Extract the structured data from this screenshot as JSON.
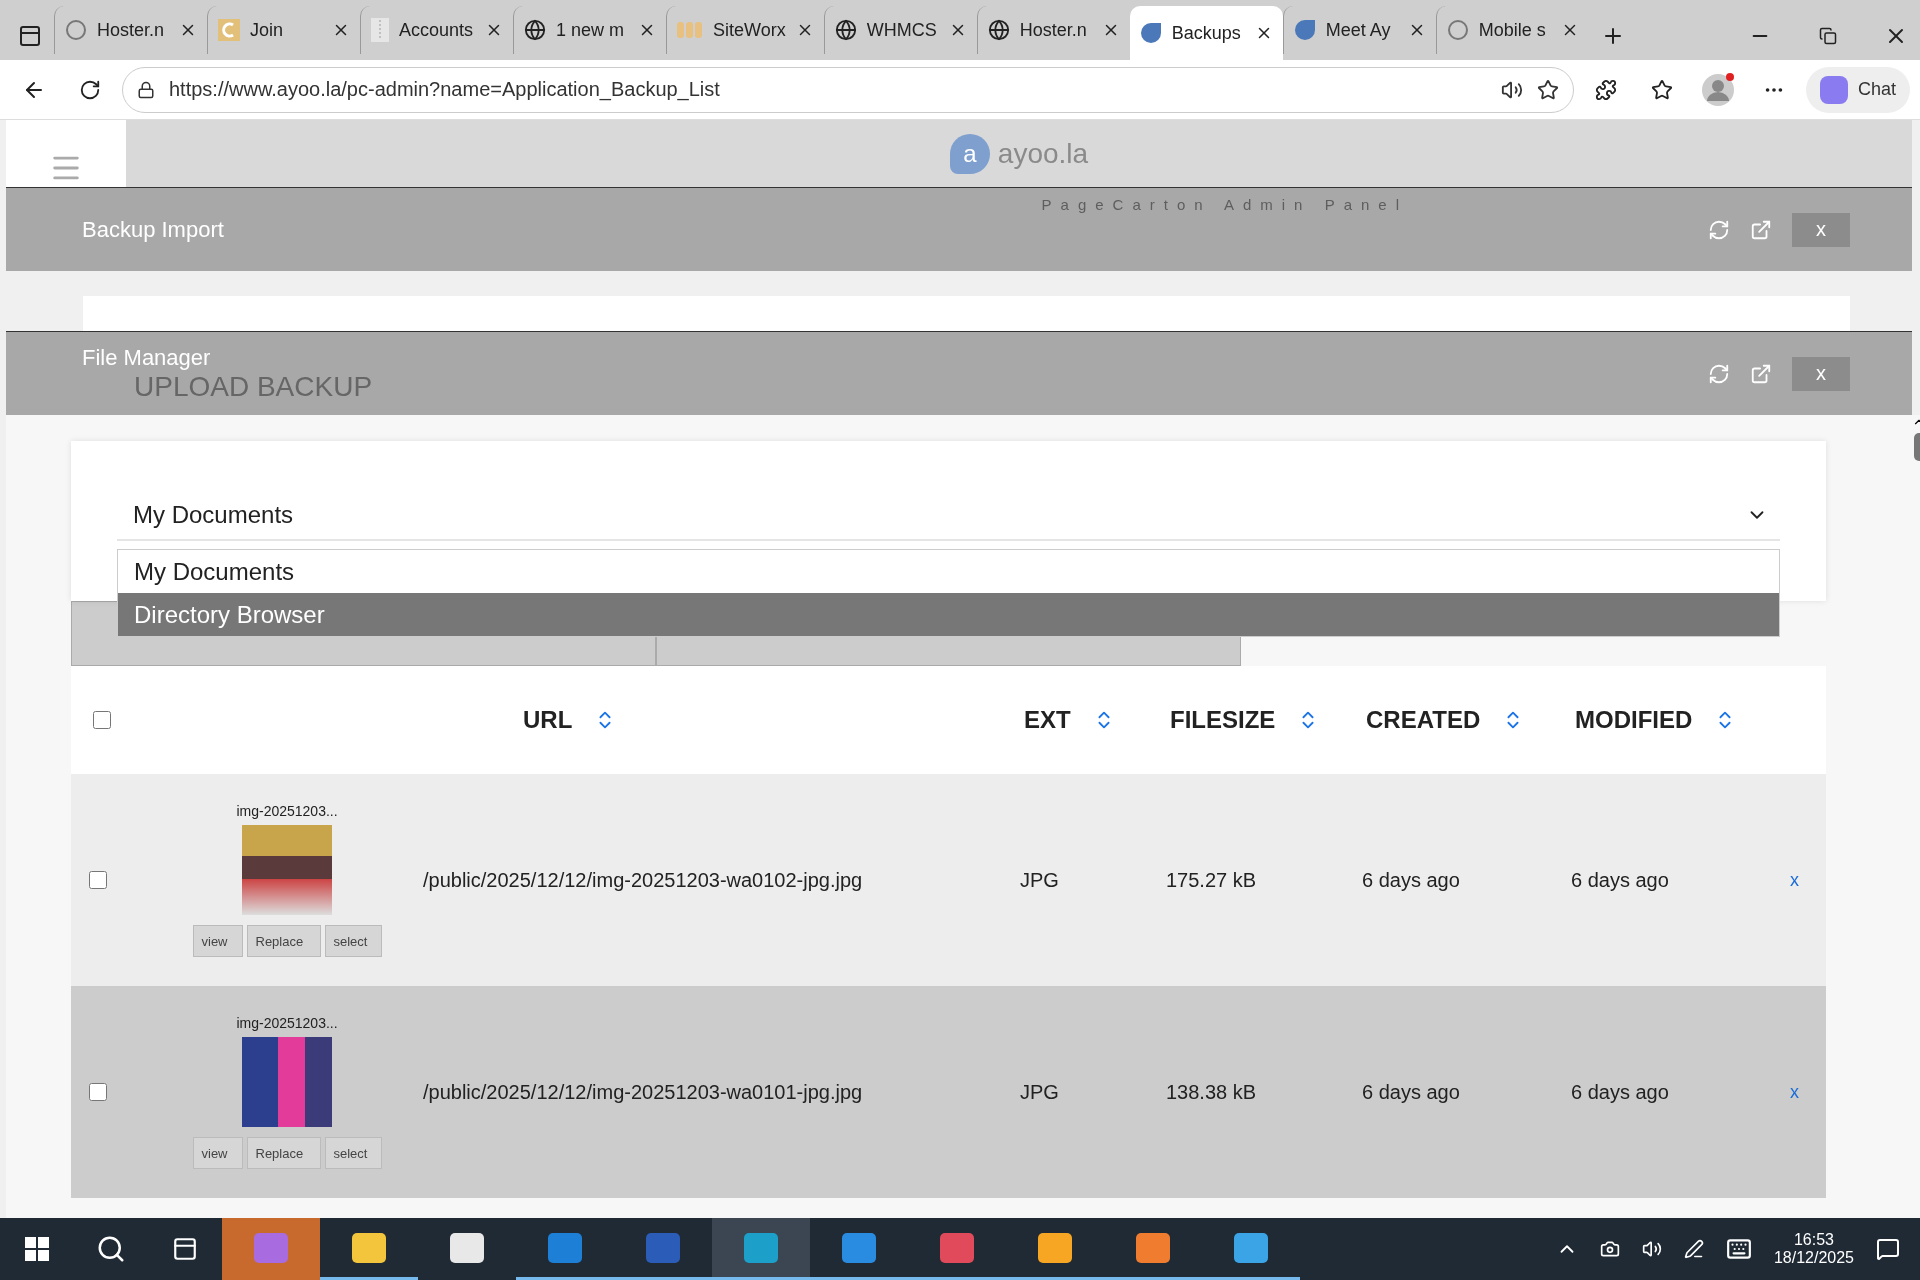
{
  "browser": {
    "tabs": [
      {
        "label": "Hoster.n",
        "selected": false
      },
      {
        "label": "Join",
        "selected": false
      },
      {
        "label": "Accounts",
        "selected": false
      },
      {
        "label": "1 new m",
        "selected": false
      },
      {
        "label": "SiteWorx",
        "selected": false
      },
      {
        "label": "WHMCS",
        "selected": false
      },
      {
        "label": "Hoster.n",
        "selected": false
      },
      {
        "label": "Backups",
        "selected": true
      },
      {
        "label": "Meet Ay",
        "selected": false
      },
      {
        "label": "Mobile s",
        "selected": false
      }
    ],
    "address": "https://www.ayoo.la/pc-admin?name=Application_Backup_List",
    "chat": "Chat"
  },
  "admin_header": {
    "logo_letter": "a",
    "logo_text": "ayoo.la",
    "subtitle": "PageCarton Admin Panel"
  },
  "panels": [
    {
      "title": "Backup Import",
      "close": "x"
    },
    {
      "title": "File Manager",
      "close": "x"
    }
  ],
  "upload_heading": "UPLOAD BACKUP",
  "folder_select": {
    "value": "My Documents",
    "options": [
      {
        "label": "My Documents",
        "highlighted": false
      },
      {
        "label": "Directory Browser",
        "highlighted": true
      }
    ]
  },
  "table": {
    "select_all_checked": false,
    "columns": [
      "URL",
      "EXT",
      "FILESIZE",
      "CREATED",
      "MODIFIED"
    ],
    "rows": [
      {
        "name": "img-20251203...",
        "checked": false,
        "highlighted": false,
        "buttons": [
          "view",
          "Replace",
          "select"
        ],
        "url": "/public/2025/12/12/img-20251203-wa0102-jpg.jpg",
        "ext": "JPG",
        "filesize": "175.27 kB",
        "created": "6 days ago",
        "modified": "6 days ago",
        "delete": "x"
      },
      {
        "name": "img-20251203...",
        "checked": false,
        "highlighted": true,
        "buttons": [
          "view",
          "Replace",
          "select"
        ],
        "url": "/public/2025/12/12/img-20251203-wa0101-jpg.jpg",
        "ext": "JPG",
        "filesize": "138.38 kB",
        "created": "6 days ago",
        "modified": "6 days ago",
        "delete": "x"
      }
    ]
  },
  "taskbar": {
    "time": "16:53",
    "date": "18/12/2025",
    "apps": [
      {
        "kind": "copilot",
        "selected": false,
        "flashing": true,
        "running": false
      },
      {
        "kind": "folder",
        "selected": false,
        "flashing": false,
        "running": true
      },
      {
        "kind": "store",
        "selected": false,
        "flashing": false,
        "running": false
      },
      {
        "kind": "mail",
        "selected": false,
        "flashing": false,
        "running": true
      },
      {
        "kind": "word",
        "selected": false,
        "flashing": false,
        "running": true
      },
      {
        "kind": "browser",
        "selected": true,
        "flashing": false,
        "running": true
      },
      {
        "kind": "code",
        "selected": false,
        "flashing": false,
        "running": true
      },
      {
        "kind": "scissors",
        "selected": false,
        "flashing": false,
        "running": true
      },
      {
        "kind": "ring",
        "selected": false,
        "flashing": false,
        "running": true
      },
      {
        "kind": "xampp",
        "selected": false,
        "flashing": false,
        "running": true
      },
      {
        "kind": "photos",
        "selected": false,
        "flashing": false,
        "running": true
      }
    ]
  }
}
